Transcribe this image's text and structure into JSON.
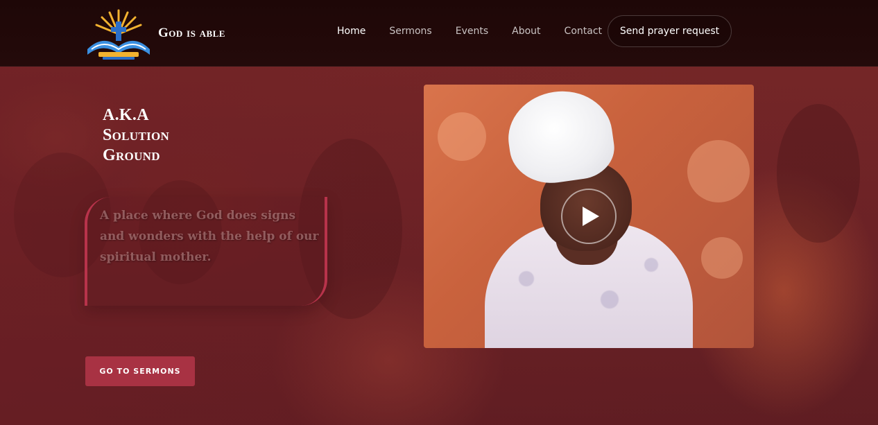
{
  "brand": {
    "name": "God is able",
    "logo_icon": "church-ministry-logo-icon"
  },
  "nav": {
    "items": [
      {
        "label": "Home",
        "active": true
      },
      {
        "label": "Sermons",
        "active": false
      },
      {
        "label": "Events",
        "active": false
      },
      {
        "label": "About",
        "active": false
      },
      {
        "label": "Contact",
        "active": false
      }
    ],
    "cta_label": "Send prayer request"
  },
  "hero": {
    "aka_lines": [
      "A.K.A",
      "Solution",
      "Ground"
    ],
    "quote": "A place where God does signs and wonders with the help of our spiritual mother.",
    "button_label": "GO TO SERMONS",
    "video_icon": "play-icon"
  },
  "colors": {
    "accent": "#a83243",
    "nav_bg": "#1e0707",
    "hero_tint": "#6e2427"
  }
}
